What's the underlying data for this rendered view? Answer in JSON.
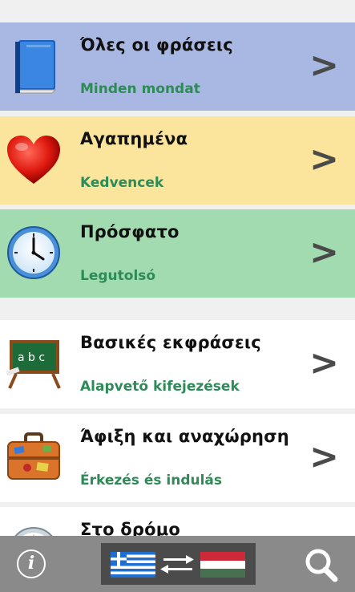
{
  "categories": [
    {
      "title": "Όλες οι φράσεις",
      "subtitle": "Minden mondat",
      "chevron": ">",
      "icon": "book-icon",
      "color": "#a9b7e3"
    },
    {
      "title": "Αγαπημένα",
      "subtitle": "Kedvencek",
      "chevron": ">",
      "icon": "heart-icon",
      "color": "#fbe49b"
    },
    {
      "title": "Πρόσφατο",
      "subtitle": "Legutolsó",
      "chevron": ">",
      "icon": "clock-icon",
      "color": "#a3dbb0"
    },
    {
      "title": "Βασικές εκφράσεις",
      "subtitle": "Alapvető kifejezések",
      "chevron": ">",
      "icon": "chalkboard-icon",
      "color": "#ffffff"
    },
    {
      "title": "Άφιξη και αναχώρηση",
      "subtitle": "Érkezés és indulás",
      "chevron": ">",
      "icon": "suitcase-icon",
      "color": "#ffffff"
    },
    {
      "title": "Στο δρόμο",
      "subtitle": "",
      "chevron": "",
      "icon": "compass-icon",
      "color": "#ffffff"
    }
  ],
  "bottom_bar": {
    "info_label": "i",
    "language_pair": {
      "from": "greece-flag-icon",
      "to": "hungary-flag-icon",
      "swap": "swap-arrows-icon"
    },
    "search": "search-icon"
  },
  "colors": {
    "subtitle": "#2e8b57",
    "bar": "#8a8a8a",
    "lang_bg": "#4b4b4b"
  }
}
